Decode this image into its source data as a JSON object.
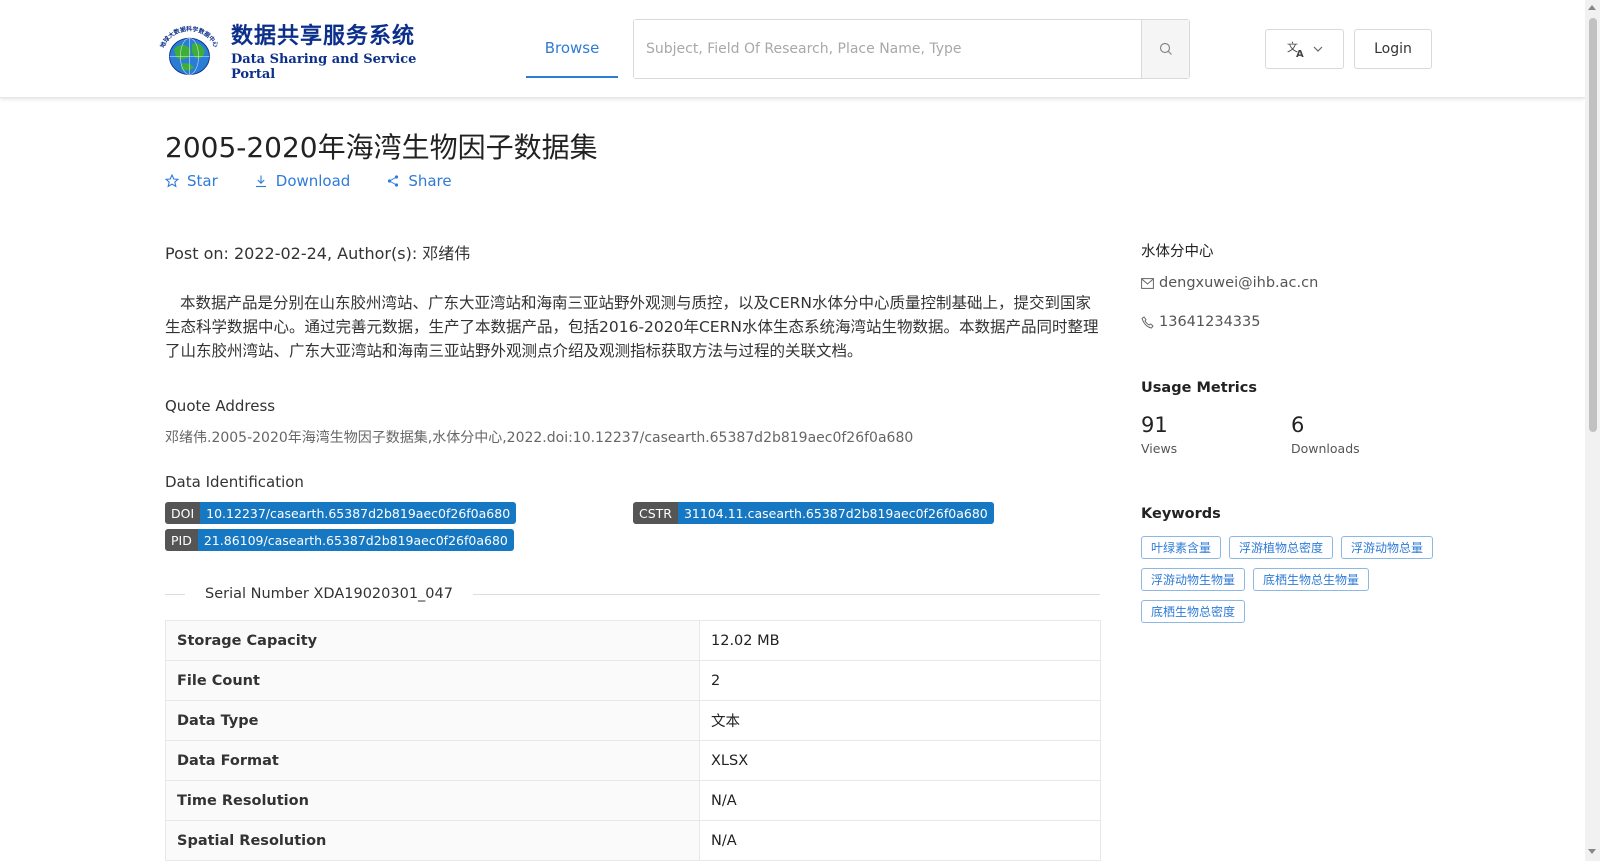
{
  "header": {
    "logo": {
      "cn": "数据共享服务系统",
      "en": "Data Sharing and Service Portal",
      "ring_text": "地球大数据科学数据中心"
    },
    "nav_browse": "Browse",
    "search_placeholder": "Subject, Field Of Research, Place Name, Type",
    "login": "Login"
  },
  "dataset": {
    "title": "2005-2020年海湾生物因子数据集",
    "actions": {
      "star": "Star",
      "download": "Download",
      "share": "Share"
    },
    "meta_line": "Post on: 2022-02-24, Author(s): 邓绪伟",
    "description": "本数据产品是分别在山东胶州湾站、广东大亚湾站和海南三亚站野外观测与质控，以及CERN水体分中心质量控制基础上，提交到国家生态科学数据中心。通过完善元数据，生产了本数据产品，包括2016-2020年CERN水体生态系统海湾站生物数据。本数据产品同时整理了山东胶州湾站、广东大亚湾站和海南三亚站野外观测点介绍及观测指标获取方法与过程的关联文档。",
    "quote_label": "Quote Address",
    "quote_text": "邓绪伟.2005-2020年海湾生物因子数据集,水体分中心,2022.doi:10.12237/casearth.65387d2b819aec0f26f0a680",
    "ident_label": "Data Identification",
    "ids": {
      "doi_key": "DOI",
      "doi_val": "10.12237/casearth.65387d2b819aec0f26f0a680",
      "cstr_key": "CSTR",
      "cstr_val": "31104.11.casearth.65387d2b819aec0f26f0a680",
      "pid_key": "PID",
      "pid_val": "21.86109/casearth.65387d2b819aec0f26f0a680"
    },
    "serial": "Serial Number XDA19020301_047",
    "table": [
      {
        "key": "Storage Capacity",
        "value": "12.02 MB"
      },
      {
        "key": "File Count",
        "value": "2"
      },
      {
        "key": "Data Type",
        "value": "文本"
      },
      {
        "key": "Data Format",
        "value": "XLSX"
      },
      {
        "key": "Time Resolution",
        "value": "N/A"
      },
      {
        "key": "Spatial Resolution",
        "value": "N/A"
      }
    ]
  },
  "sidebar": {
    "org": "水体分中心",
    "email": "dengxuwei@ihb.ac.cn",
    "phone": "13641234335",
    "usage_heading": "Usage Metrics",
    "views_num": "91",
    "views_label": "Views",
    "downloads_num": "6",
    "downloads_label": "Downloads",
    "keywords_heading": "Keywords",
    "keywords": [
      "叶绿素含量",
      "浮游植物总密度",
      "浮游动物总量",
      "浮游动物生物量",
      "底栖生物总生物量",
      "底栖生物总密度"
    ]
  },
  "colors": {
    "accent": "#2f7bd6",
    "badge_key": "#555555",
    "badge_value": "#1678c2",
    "logo_blue": "#0b2f8a"
  }
}
